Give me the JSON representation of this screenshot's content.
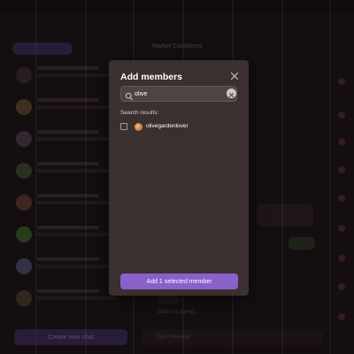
{
  "modal": {
    "title": "Add members",
    "search": {
      "value": "olive",
      "placeholder": ""
    },
    "results_label": "Search results:",
    "results": [
      {
        "name": "olivegardenlover",
        "selected": false
      }
    ],
    "add_button_label": "Add 1 selected member"
  },
  "background": {
    "tabs": [
      "",
      ""
    ],
    "chat_header_title": "Market Conditions",
    "new_chat_label": "Create new chat",
    "typing_text": "Ellison is typing...",
    "compose_placeholder": "Type message"
  },
  "colors": {
    "modal_bg": "#3a302f",
    "accent": "#8a60c9",
    "page_bg": "#1b1416"
  },
  "icons": {
    "close": "close-icon",
    "search": "search-icon",
    "clear": "clear-icon",
    "avatar": "user-avatar"
  }
}
